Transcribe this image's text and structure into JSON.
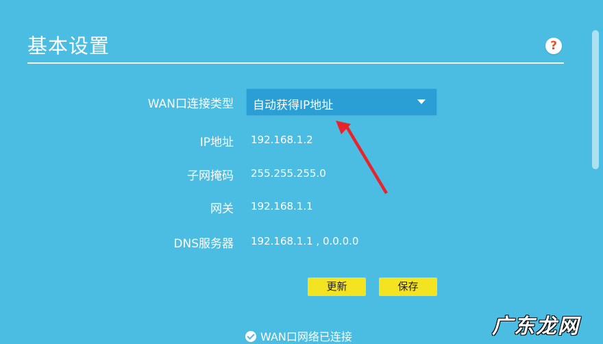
{
  "header": {
    "title": "基本设置",
    "help_symbol": "?"
  },
  "wan_form": {
    "connection_type_label": "WAN口连接类型",
    "connection_type_value": "自动获得IP地址",
    "ip_label": "IP地址",
    "ip_value": "192.168.1.2",
    "subnet_label": "子网掩码",
    "subnet_value": "255.255.255.0",
    "gateway_label": "网关",
    "gateway_value": "192.168.1.1",
    "dns_label": "DNS服务器",
    "dns_value": "192.168.1.1 , 0.0.0.0"
  },
  "buttons": {
    "refresh_label": "更新",
    "save_label": "保存"
  },
  "status": {
    "text": "WAN口网络已连接"
  },
  "watermark": {
    "text": "广东龙网"
  },
  "colors": {
    "background": "#4bbde2",
    "select_bg": "#2a9fd6",
    "button_bg": "#f4e321",
    "help_icon": "#e8542a",
    "annotation_arrow": "#e8242a"
  },
  "icons": {
    "help": "question-mark-circle-icon",
    "dropdown": "caret-down-icon",
    "status": "check-circle-icon",
    "annotation": "red-arrow-icon"
  }
}
